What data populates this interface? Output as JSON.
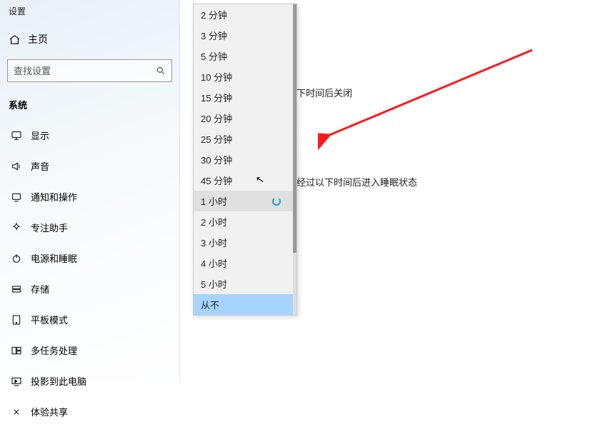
{
  "app_title": "设置",
  "home_label": "主页",
  "search": {
    "placeholder": "查找设置"
  },
  "section_label": "系统",
  "nav": [
    {
      "icon": "display",
      "label": "显示"
    },
    {
      "icon": "sound",
      "label": "声音"
    },
    {
      "icon": "notify",
      "label": "通知和操作"
    },
    {
      "icon": "focus",
      "label": "专注助手"
    },
    {
      "icon": "power",
      "label": "电源和睡眠"
    },
    {
      "icon": "storage",
      "label": "存储"
    },
    {
      "icon": "tablet",
      "label": "平板模式"
    },
    {
      "icon": "multitask",
      "label": "多任务处理"
    },
    {
      "icon": "project",
      "label": "投影到此电脑"
    },
    {
      "icon": "share",
      "label": "体验共享"
    }
  ],
  "hint1": "下时间后关闭",
  "hint2": "经过以下时间后进入睡眠状态",
  "dropdown": {
    "selected": "1 小时",
    "hovered": "从不",
    "options": [
      "2 分钟",
      "3 分钟",
      "5 分钟",
      "10 分钟",
      "15 分钟",
      "20 分钟",
      "25 分钟",
      "30 分钟",
      "45 分钟",
      "1 小时",
      "2 小时",
      "3 小时",
      "4 小时",
      "5 小时",
      "从不"
    ]
  }
}
